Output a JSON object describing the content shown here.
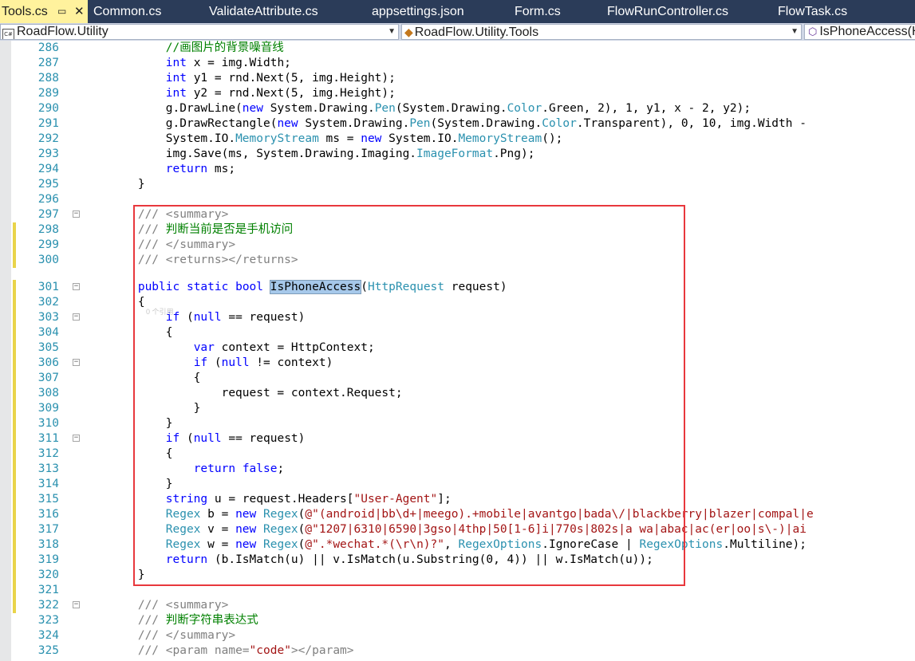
{
  "tabs": [
    {
      "label": "Tools.cs",
      "active": true,
      "close": "✕",
      "pin": "▭"
    },
    {
      "label": "Common.cs"
    },
    {
      "label": "ValidateAttribute.cs"
    },
    {
      "label": "appsettings.json"
    },
    {
      "label": "Form.cs"
    },
    {
      "label": "FlowRunController.cs"
    },
    {
      "label": "FlowTask.cs"
    }
  ],
  "navbar": {
    "project": "RoadFlow.Utility",
    "project_icon": "C#",
    "type": "RoadFlow.Utility.Tools",
    "member": "IsPhoneAccess(H"
  },
  "editor": {
    "reference_hint": "0 个引用",
    "lines": [
      {
        "num": "286",
        "code": "            <span class=\"cm\">//画图片的背景噪音线</span>"
      },
      {
        "num": "287",
        "code": "            <span class=\"kw\">int</span> x = img.Width;"
      },
      {
        "num": "288",
        "code": "            <span class=\"kw\">int</span> y1 = rnd.Next(5, img.Height);"
      },
      {
        "num": "289",
        "code": "            <span class=\"kw\">int</span> y2 = rnd.Next(5, img.Height);"
      },
      {
        "num": "290",
        "code": "            g.DrawLine(<span class=\"kw\">new</span> System.Drawing.<span class=\"ty\">Pen</span>(System.Drawing.<span class=\"ty\">Color</span>.Green, 2), 1, y1, x - 2, y2);"
      },
      {
        "num": "291",
        "code": "            g.DrawRectangle(<span class=\"kw\">new</span> System.Drawing.<span class=\"ty\">Pen</span>(System.Drawing.<span class=\"ty\">Color</span>.Transparent), 0, 10, img.Width -"
      },
      {
        "num": "292",
        "code": "            System.IO.<span class=\"ty\">MemoryStream</span> ms = <span class=\"kw\">new</span> System.IO.<span class=\"ty\">MemoryStream</span>();"
      },
      {
        "num": "293",
        "code": "            img.Save(ms, System.Drawing.Imaging.<span class=\"ty\">ImageFormat</span>.Png);"
      },
      {
        "num": "294",
        "code": "            <span class=\"kw\">return</span> ms;"
      },
      {
        "num": "295",
        "code": "        }"
      },
      {
        "num": "296",
        "code": ""
      },
      {
        "num": "297",
        "code": "        <span class=\"dc\">///</span> <span class=\"dc\">&lt;summary&gt;</span>",
        "fold": "−"
      },
      {
        "num": "298",
        "code": "        <span class=\"dc\">///</span> <span class=\"cm\">判断当前是否是手机访问</span>",
        "changed": true
      },
      {
        "num": "299",
        "code": "        <span class=\"dc\">///</span> <span class=\"dc\">&lt;/summary&gt;</span>",
        "changed": true
      },
      {
        "num": "300",
        "code": "        <span class=\"dc\">///</span> <span class=\"dc\">&lt;returns&gt;&lt;/returns&gt;</span>",
        "changed": true
      },
      {
        "num": "301",
        "code": "        <span class=\"kw\">public</span> <span class=\"kw\">static</span> <span class=\"kw\">bool</span> <span class=\"hl\">IsPhoneAccess</span>(<span class=\"ty\">HttpRequest</span> request)",
        "fold": "−",
        "changed": true
      },
      {
        "num": "302",
        "code": "        {",
        "changed": true
      },
      {
        "num": "303",
        "code": "            <span class=\"kw\">if</span> (<span class=\"kw\">null</span> == request)",
        "fold": "−",
        "changed": true
      },
      {
        "num": "304",
        "code": "            {",
        "changed": true
      },
      {
        "num": "305",
        "code": "                <span class=\"kw\">var</span> context = HttpContext;",
        "changed": true
      },
      {
        "num": "306",
        "code": "                <span class=\"kw\">if</span> (<span class=\"kw\">null</span> != context)",
        "fold": "−",
        "changed": true
      },
      {
        "num": "307",
        "code": "                {",
        "changed": true
      },
      {
        "num": "308",
        "code": "                    request = context.Request;",
        "changed": true
      },
      {
        "num": "309",
        "code": "                }",
        "changed": true
      },
      {
        "num": "310",
        "code": "            }",
        "changed": true
      },
      {
        "num": "311",
        "code": "            <span class=\"kw\">if</span> (<span class=\"kw\">null</span> == request)",
        "fold": "−",
        "changed": true
      },
      {
        "num": "312",
        "code": "            {",
        "changed": true
      },
      {
        "num": "313",
        "code": "                <span class=\"kw\">return</span> <span class=\"kw\">false</span>;",
        "changed": true
      },
      {
        "num": "314",
        "code": "            }",
        "changed": true
      },
      {
        "num": "315",
        "code": "            <span class=\"kw\">string</span> u = request.Headers[<span class=\"st\">\"User-Agent\"</span>];",
        "changed": true
      },
      {
        "num": "316",
        "code": "            <span class=\"ty\">Regex</span> b = <span class=\"kw\">new</span> <span class=\"ty\">Regex</span>(<span class=\"st\">@\"(android|bb\\d+|meego).+mobile|avantgo|bada\\/|blackberry|blazer|compal|e</span>",
        "changed": true
      },
      {
        "num": "317",
        "code": "            <span class=\"ty\">Regex</span> v = <span class=\"kw\">new</span> <span class=\"ty\">Regex</span>(<span class=\"st\">@\"1207|6310|6590|3gso|4thp|50[1-6]i|770s|802s|a wa|abac|ac(er|oo|s\\-)|ai</span>",
        "changed": true
      },
      {
        "num": "318",
        "code": "            <span class=\"ty\">Regex</span> w = <span class=\"kw\">new</span> <span class=\"ty\">Regex</span>(<span class=\"st\">@\".*wechat.*(\\r\\n)?\"</span>, <span class=\"ty\">RegexOptions</span>.IgnoreCase | <span class=\"ty\">RegexOptions</span>.Multiline);",
        "changed": true
      },
      {
        "num": "319",
        "code": "            <span class=\"kw\">return</span> (b.IsMatch(u) || v.IsMatch(u.Substring(0, 4)) || w.IsMatch(u));",
        "changed": true
      },
      {
        "num": "320",
        "code": "        }",
        "changed": true
      },
      {
        "num": "321",
        "code": "",
        "changed": true
      },
      {
        "num": "322",
        "code": "        <span class=\"dc\">///</span> <span class=\"dc\">&lt;summary&gt;</span>",
        "fold": "−",
        "changed": true
      },
      {
        "num": "323",
        "code": "        <span class=\"dc\">///</span> <span class=\"cm\">判断字符串表达式</span>"
      },
      {
        "num": "324",
        "code": "        <span class=\"dc\">///</span> <span class=\"dc\">&lt;/summary&gt;</span>"
      },
      {
        "num": "325",
        "code": "        <span class=\"dc\">///</span> <span class=\"dc\">&lt;param name=</span><span class=\"st\">\"code\"</span><span class=\"dc\">&gt;&lt;/param&gt;</span>"
      }
    ]
  },
  "colors": {
    "tabstrip_bg": "#2b3c59",
    "active_tab_bg": "#fff29d",
    "keyword": "#0000ff",
    "type": "#2b91af",
    "string": "#a31515",
    "comment": "#008000",
    "line_number": "#2b91af",
    "highlight_box": "#e8383d",
    "change_marker": "#e9d44a"
  }
}
